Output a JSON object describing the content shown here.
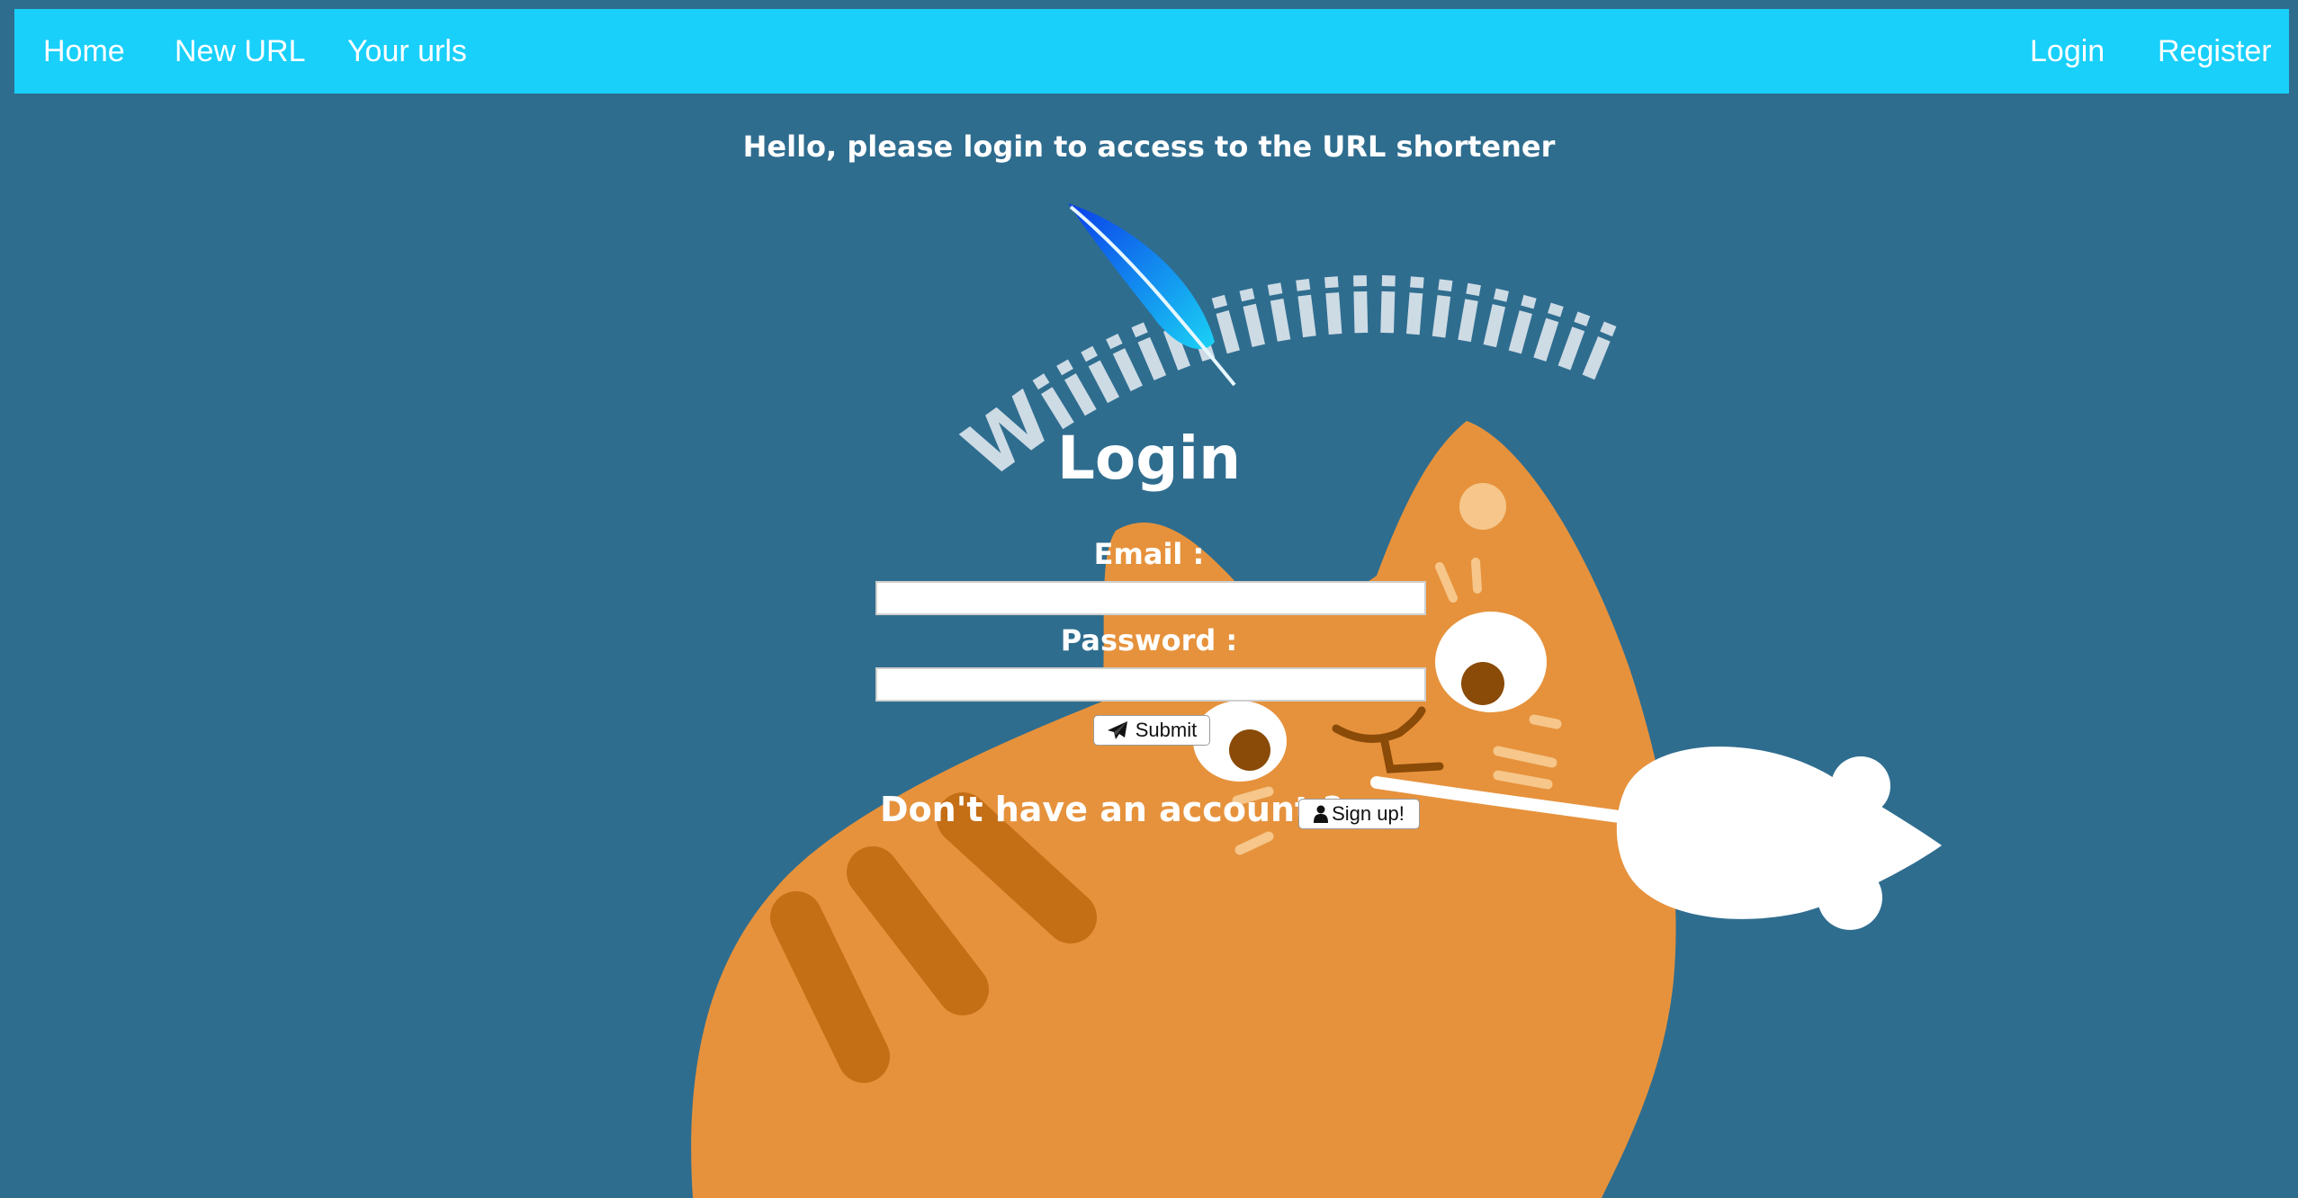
{
  "nav": {
    "home": "Home",
    "new_url": "New URL",
    "your_urls": "Your urls",
    "login": "Login",
    "register": "Register"
  },
  "greeting": "Hello, please login to access to the URL shortener",
  "illustration": {
    "arc_text": "Wiiiiiiiiiiiiiiiiiiiiii"
  },
  "form": {
    "title": "Login",
    "email_label": "Email :",
    "email_value": "",
    "password_label": "Password :",
    "password_value": "",
    "submit_label": "Submit"
  },
  "signup": {
    "prompt": "Don't have an account ?",
    "button_label": "Sign up!"
  },
  "colors": {
    "background": "#2f6d8f",
    "navbar": "#19d0fb",
    "cat": "#e6923c",
    "stripes": "#c46e15"
  },
  "icons": [
    "paper-plane-icon",
    "user-icon",
    "feather-icon"
  ]
}
